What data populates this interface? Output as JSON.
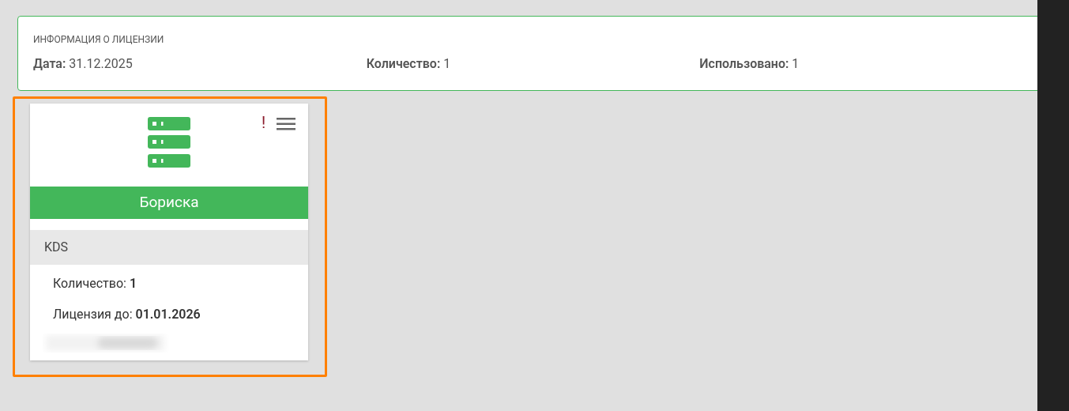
{
  "license_info": {
    "title": "ИНФОРМАЦИЯ О ЛИЦЕНЗИИ",
    "fields": [
      {
        "label": "Дата:",
        "value": "31.12.2025"
      },
      {
        "label": "Количество:",
        "value": "1"
      },
      {
        "label": "Использовано:",
        "value": "1"
      }
    ]
  },
  "device_card": {
    "selected": true,
    "alert": "!",
    "name": "Бориска",
    "module": "KDS",
    "details": [
      {
        "label": "Количество:",
        "value": "1"
      },
      {
        "label": "Лицензия до:",
        "value": "01.01.2026"
      }
    ]
  }
}
